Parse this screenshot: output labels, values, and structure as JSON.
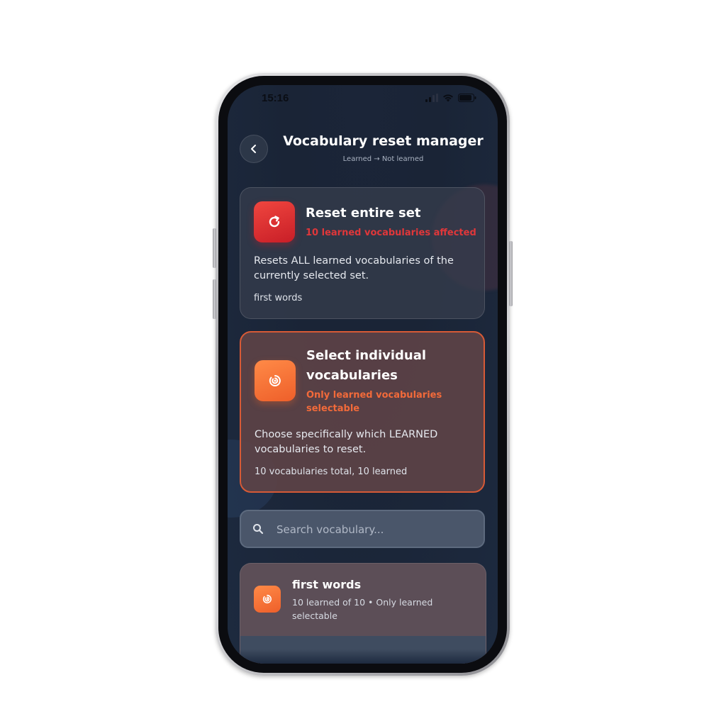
{
  "status_bar": {
    "time": "15:16",
    "icons": [
      "signal-icon",
      "wifi-icon",
      "battery-icon"
    ]
  },
  "header": {
    "back_icon": "chevron-left-icon",
    "title": "Vocabulary reset manager",
    "subtitle": "Learned → Not learned"
  },
  "reset_card": {
    "icon": "refresh-icon",
    "title": "Reset entire set",
    "tag": "10 learned vocabularies affected",
    "description": "Resets ALL learned vocabularies of the currently selected set.",
    "meta": "first words",
    "accent": "#e0373a"
  },
  "select_card": {
    "icon": "target-icon",
    "title": "Select individual vocabularies",
    "tag": "Only learned vocabularies selectable",
    "description": "Choose specifically which LEARNED vocabularies to reset.",
    "meta": "10 vocabularies total, 10 learned",
    "accent": "#f26a3a"
  },
  "search": {
    "icon": "search-icon",
    "placeholder": "Search vocabulary..."
  },
  "set_list": [
    {
      "icon": "target-icon",
      "title": "first words",
      "subtitle": "10 learned of 10 • Only learned selectable"
    }
  ]
}
